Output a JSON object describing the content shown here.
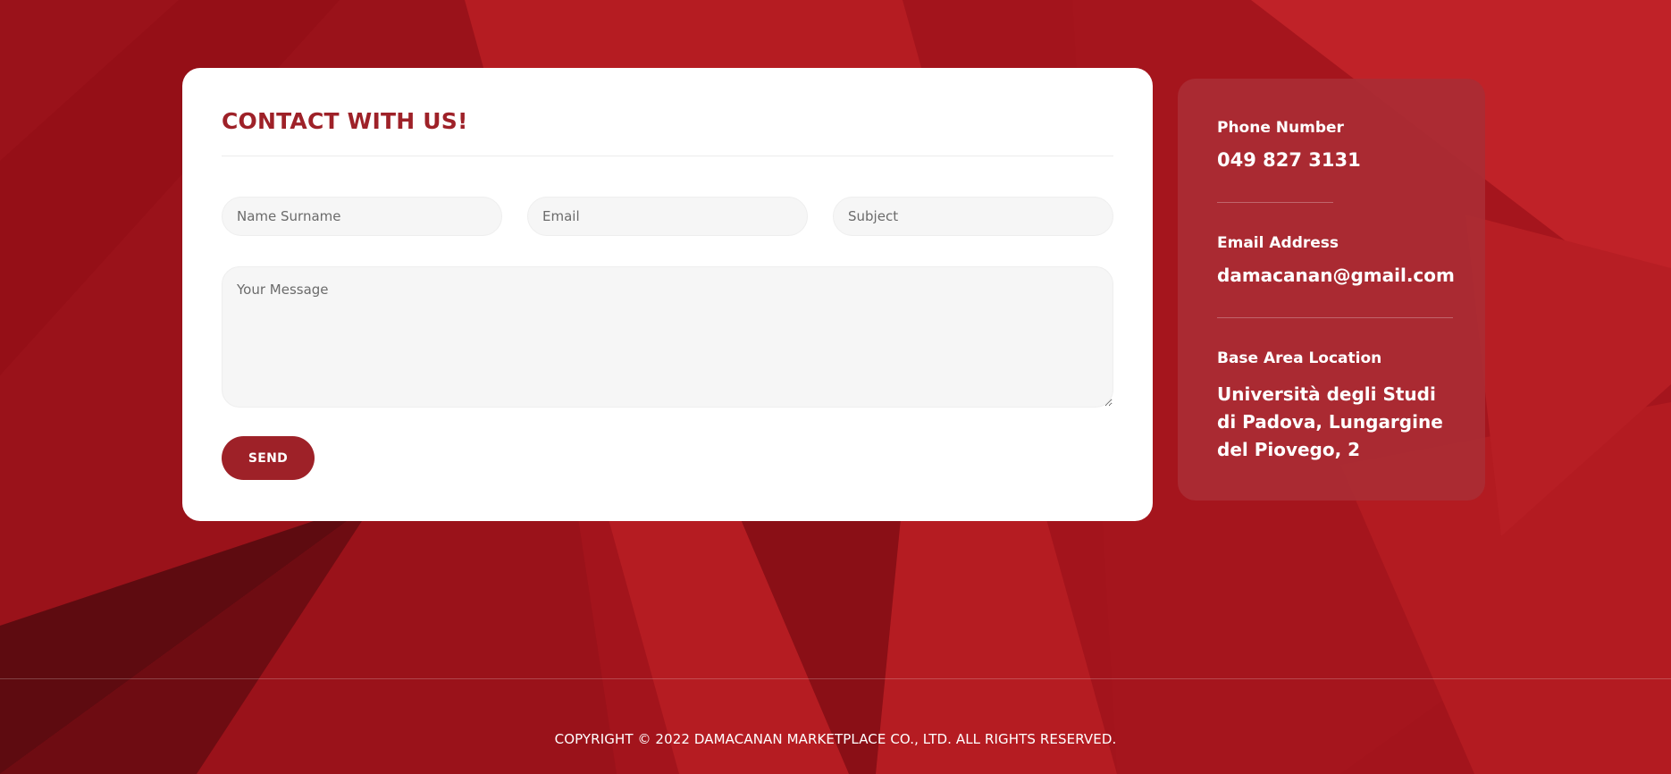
{
  "contact_form": {
    "title": "CONTACT WITH US!",
    "name_placeholder": "Name Surname",
    "email_placeholder": "Email",
    "subject_placeholder": "Subject",
    "message_placeholder": "Your Message",
    "send_label": "SEND"
  },
  "contact_info": {
    "phone_label": "Phone Number",
    "phone_value": "049 827 3131",
    "email_label": "Email Address",
    "email_value": "damacanan@gmail.com",
    "location_label": "Base Area Location",
    "location_value": "Università degli Studi di Padova, Lungargine del Piovego, 2"
  },
  "footer": {
    "copyright": "COPYRIGHT © 2022 DAMACANAN MARKETPLACE CO., LTD. ALL RIGHTS RESERVED."
  },
  "colors": {
    "brand_red": "#9e2128",
    "background_red": "#a3141c",
    "info_panel": "#aa2d34"
  }
}
